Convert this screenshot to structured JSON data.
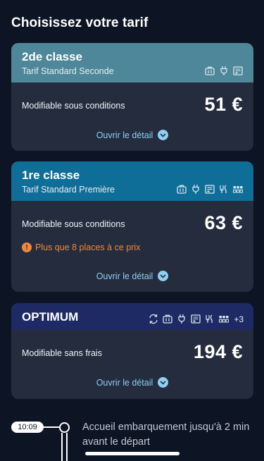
{
  "title": "Choisissez votre tarif",
  "fares": [
    {
      "class_name": "2de classe",
      "fare_name": "Tarif Standard Seconde",
      "header_color": "#4d8799",
      "amenities": [
        "suitcase-icon",
        "power-plug-icon",
        "ticket-icon"
      ],
      "condition": "Modifiable sous conditions",
      "price": "51 €",
      "detail_label": "Ouvrir le détail"
    },
    {
      "class_name": "1re classe",
      "fare_name": "Tarif Standard Première",
      "header_color": "#0f6e98",
      "amenities": [
        "suitcase-icon",
        "power-plug-icon",
        "ticket-icon",
        "meal-icon",
        "seat-icon"
      ],
      "condition": "Modifiable sous conditions",
      "warning": "Plus que 8 places à ce prix",
      "warning_icon": "!",
      "price": "63 €",
      "detail_label": "Ouvrir le détail"
    },
    {
      "class_name": "OPTIMUM",
      "header_color": "#1e2a63",
      "amenities": [
        "exchange-icon",
        "suitcase-icon",
        "power-plug-icon",
        "ticket-icon",
        "meal-icon",
        "seat-icon"
      ],
      "amenities_extra": "+3",
      "condition": "Modifiable sans frais",
      "price": "194 €",
      "detail_label": "Ouvrir le détail"
    }
  ],
  "timeline": {
    "time": "10:09",
    "text": "Accueil embarquement jusqu'à 2 min avant le départ"
  },
  "colors": {
    "background": "#0d1424",
    "card": "#242c3d",
    "link": "#8fd0f2",
    "warning": "#f0883a"
  }
}
